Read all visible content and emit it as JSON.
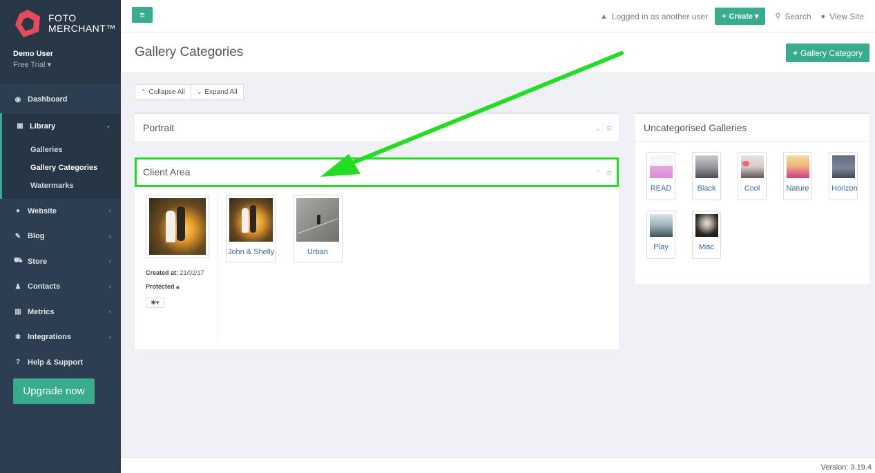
{
  "brand": {
    "line1": "FOTO",
    "line2": "MERCHANT™",
    "color": "#e8495c"
  },
  "user": {
    "name": "Demo User",
    "plan": "Free Trial"
  },
  "sidebar": {
    "items": [
      {
        "label": "Dashboard",
        "icon": "dashboard-icon"
      },
      {
        "label": "Library",
        "icon": "image-icon"
      },
      {
        "label": "Website",
        "icon": "globe-icon"
      },
      {
        "label": "Blog",
        "icon": "edit-icon"
      },
      {
        "label": "Store",
        "icon": "cart-icon"
      },
      {
        "label": "Contacts",
        "icon": "user-icon"
      },
      {
        "label": "Metrics",
        "icon": "bar-chart-icon"
      },
      {
        "label": "Integrations",
        "icon": "gear-icon"
      },
      {
        "label": "Help & Support",
        "icon": "help-icon"
      }
    ],
    "library_sub": [
      {
        "label": "Galleries"
      },
      {
        "label": "Gallery Categories"
      },
      {
        "label": "Watermarks"
      }
    ],
    "upgrade_label": "Upgrade now"
  },
  "topbar": {
    "logged_in": "Logged in as another user",
    "create": "Create",
    "search": "Search",
    "view_site": "View Site"
  },
  "page": {
    "title": "Gallery Categories",
    "add_button": "Gallery Category",
    "collapse_all": "Collapse All",
    "expand_all": "Expand All"
  },
  "categories": [
    {
      "name": "Portrait",
      "expanded": false
    },
    {
      "name": "Client Area",
      "expanded": true,
      "created_label": "Created at:",
      "created_value": "21/02/17",
      "protected_label": "Protected",
      "galleries": [
        {
          "name": "John & Shelly"
        },
        {
          "name": "Urban"
        }
      ]
    }
  ],
  "uncategorised": {
    "title": "Uncategorised Galleries",
    "galleries": [
      {
        "name": "READ"
      },
      {
        "name": "Black"
      },
      {
        "name": "Cool"
      },
      {
        "name": "Nature"
      },
      {
        "name": "Horizon"
      },
      {
        "name": "Play"
      },
      {
        "name": "Misc"
      }
    ]
  },
  "footer": {
    "version": "Version: 3.19.4"
  },
  "colors": {
    "accent": "#3aac8e",
    "sidebar": "#2c3e50",
    "highlight": "#22dd22",
    "link": "#3b6aa0"
  }
}
